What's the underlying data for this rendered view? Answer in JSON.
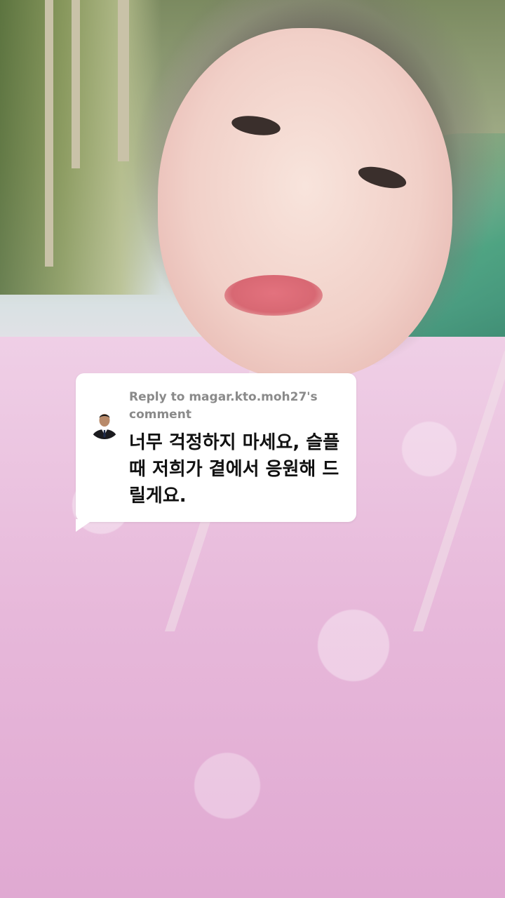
{
  "comment_sticker": {
    "reply_label": "Reply to magar.kto.moh27's comment",
    "comment_text": "너무 걱정하지 마세요, 슬플 때 저희가 곁에서 응원해 드릴게요.",
    "avatar_icon": "person-in-suit-avatar"
  },
  "colors": {
    "card_background": "#ffffff",
    "reply_label": "#8a8a8a",
    "comment_text": "#111111"
  }
}
